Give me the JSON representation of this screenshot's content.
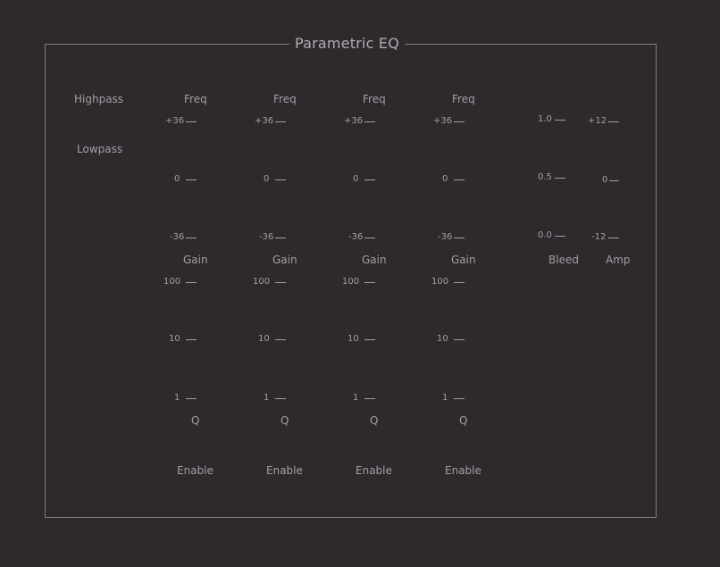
{
  "panel": {
    "title": "Parametric EQ"
  },
  "filters": {
    "highpass_label": "Highpass",
    "lowpass_label": "Lowpass"
  },
  "bands": [
    {
      "freq_label": "Freq",
      "gain_label": "Gain",
      "q_label": "Q",
      "enable_label": "Enable"
    },
    {
      "freq_label": "Freq",
      "gain_label": "Gain",
      "q_label": "Q",
      "enable_label": "Enable"
    },
    {
      "freq_label": "Freq",
      "gain_label": "Gain",
      "q_label": "Q",
      "enable_label": "Enable"
    },
    {
      "freq_label": "Freq",
      "gain_label": "Gain",
      "q_label": "Q",
      "enable_label": "Enable"
    }
  ],
  "gain_scale": {
    "top": "+36",
    "mid": "0",
    "bottom": "-36"
  },
  "q_scale": {
    "top": "100",
    "mid": "10",
    "bottom": "1"
  },
  "bleed": {
    "label": "Bleed",
    "top": "1.0",
    "mid": "0.5",
    "bottom": "0.0"
  },
  "amp": {
    "label": "Amp",
    "top": "+12",
    "mid": "0",
    "bottom": "-12"
  }
}
